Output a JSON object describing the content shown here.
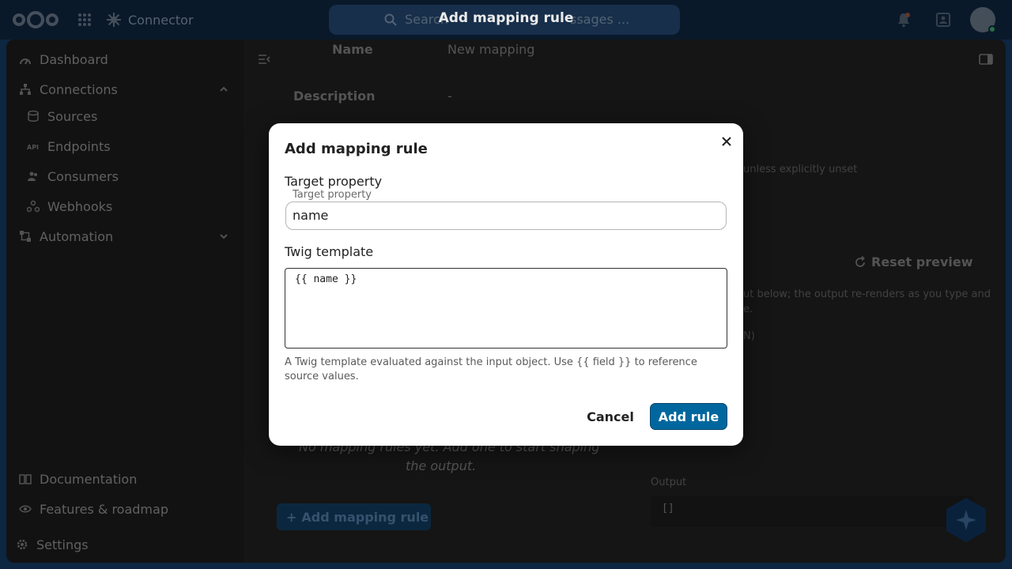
{
  "header": {
    "app_name": "Connector",
    "search_placeholder": "Search apps, files, tags, messages ...",
    "search_visible_prefix": "Search",
    "search_visible_suffix": "ssages ...",
    "modal_heading": "Add mapping rule"
  },
  "sidebar": {
    "items": [
      {
        "label": "Dashboard",
        "icon": "dashboard-icon"
      },
      {
        "label": "Connections",
        "icon": "connections-icon"
      },
      {
        "label": "Sources",
        "icon": "database-icon"
      },
      {
        "label": "Endpoints",
        "icon": "api-icon"
      },
      {
        "label": "Consumers",
        "icon": "users-icon"
      },
      {
        "label": "Webhooks",
        "icon": "webhook-icon"
      },
      {
        "label": "Automation",
        "icon": "automation-icon"
      }
    ],
    "footer": [
      {
        "label": "Documentation",
        "icon": "book-icon"
      },
      {
        "label": "Features & roadmap",
        "icon": "eye-icon"
      },
      {
        "label": "Settings",
        "icon": "gear-icon"
      }
    ]
  },
  "main": {
    "name_label": "Name",
    "name_value": "New mapping",
    "description_label": "Description",
    "description_value": "-",
    "unset_note": "unless explicitly unset",
    "reset_preview": "Reset preview",
    "preview_hint_1": "ut below; the output re-renders as you type and",
    "preview_hint_2": "e.",
    "preview_hint_3": "N)",
    "empty_rules_1": "No mapping rules yet. Add one to start shaping",
    "empty_rules_2": "the output.",
    "add_mapping_rule": "Add mapping rule",
    "output_label": "Output",
    "output_value": "[]"
  },
  "dialog": {
    "title": "Add mapping rule",
    "target_property_label": "Target property",
    "target_property_legend": "Target property",
    "target_property_value": "name",
    "twig_template_label": "Twig template",
    "twig_template_value": "{{ name }}",
    "help_text": "A Twig template evaluated against the input object. Use {{ field }} to reference source values.",
    "cancel_label": "Cancel",
    "add_label": "Add rule"
  },
  "colors": {
    "primary": "#00679e",
    "header_bg": "#0b1c2e"
  }
}
